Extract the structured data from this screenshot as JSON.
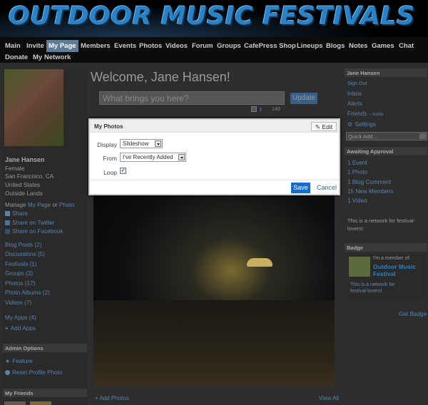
{
  "banner": {
    "title": "OUTDOOR MUSIC FESTIVALS"
  },
  "nav": {
    "row1": [
      "Main",
      "Invite",
      "My Page",
      "Members",
      "Events",
      "Photos",
      "Videos",
      "Forum",
      "Groups",
      "CafePress Shop",
      "Lineups",
      "Blogs",
      "Notes",
      "Games",
      "Chat"
    ],
    "row2": [
      "Donate",
      "My Network"
    ],
    "active": "My Page"
  },
  "profile": {
    "name": "Jane Hansen",
    "gender": "Female",
    "location": "San Francisco, CA",
    "country": "United States",
    "extra": "Outside Lands",
    "manage_prefix": "Manage",
    "manage_mypage": "My Page",
    "manage_or": "or",
    "manage_photo": "Photo",
    "share": "Share",
    "share_twitter": "Share on Twitter",
    "share_facebook": "Share on Facebook",
    "links": [
      "Blog Posts (2)",
      "Discussions (5)",
      "Festivals (1)",
      "Groups (3)",
      "Photos (17)",
      "Photo Albums (2)",
      "Videos (7)"
    ],
    "my_apps": "My Apps (4)",
    "add_apps": "Add Apps",
    "admin_options": "Admin Options",
    "feature": "Feature",
    "reset_photo": "Reset Profile Photo",
    "my_friends": "My Friends"
  },
  "center": {
    "welcome": "Welcome, Jane Hansen!",
    "status_placeholder": "What brings you here?",
    "update": "Update",
    "char_count": "140",
    "add_photos": "+ Add Photos",
    "view_all": "View All"
  },
  "modal": {
    "title": "My Photos",
    "edit": "Edit",
    "display_label": "Display",
    "display_value": "Slideshow",
    "from_label": "From",
    "from_value": "I've Recently Added",
    "loop_label": "Loop",
    "loop_checked": true,
    "save": "Save",
    "cancel": "Cancel"
  },
  "right": {
    "user_name": "Jane Hansen",
    "sign_out": "Sign Out",
    "inbox": "Inbox",
    "alerts": "Alerts",
    "friends": "Friends",
    "invite": "– Invite",
    "settings": "Settings",
    "quick_add": "Quick Add...",
    "awaiting": "Awaiting Approval",
    "approval_items": [
      "1 Event",
      "1 Photo",
      "1 Blog Comment",
      "15 New Members",
      "1 Video"
    ],
    "network_desc": "This is a network for festival-lovers!",
    "badge": "Badge",
    "badge_member": "I'm a member of:",
    "badge_network": "Outdoor Music Festival",
    "badge_desc": "This is a network for festival-lovers!",
    "get_badge": "Get Badge"
  },
  "colors": {
    "accent": "#1b6ac6",
    "nav_active": "#5c7c99",
    "banner_title": "#2c80c4"
  }
}
